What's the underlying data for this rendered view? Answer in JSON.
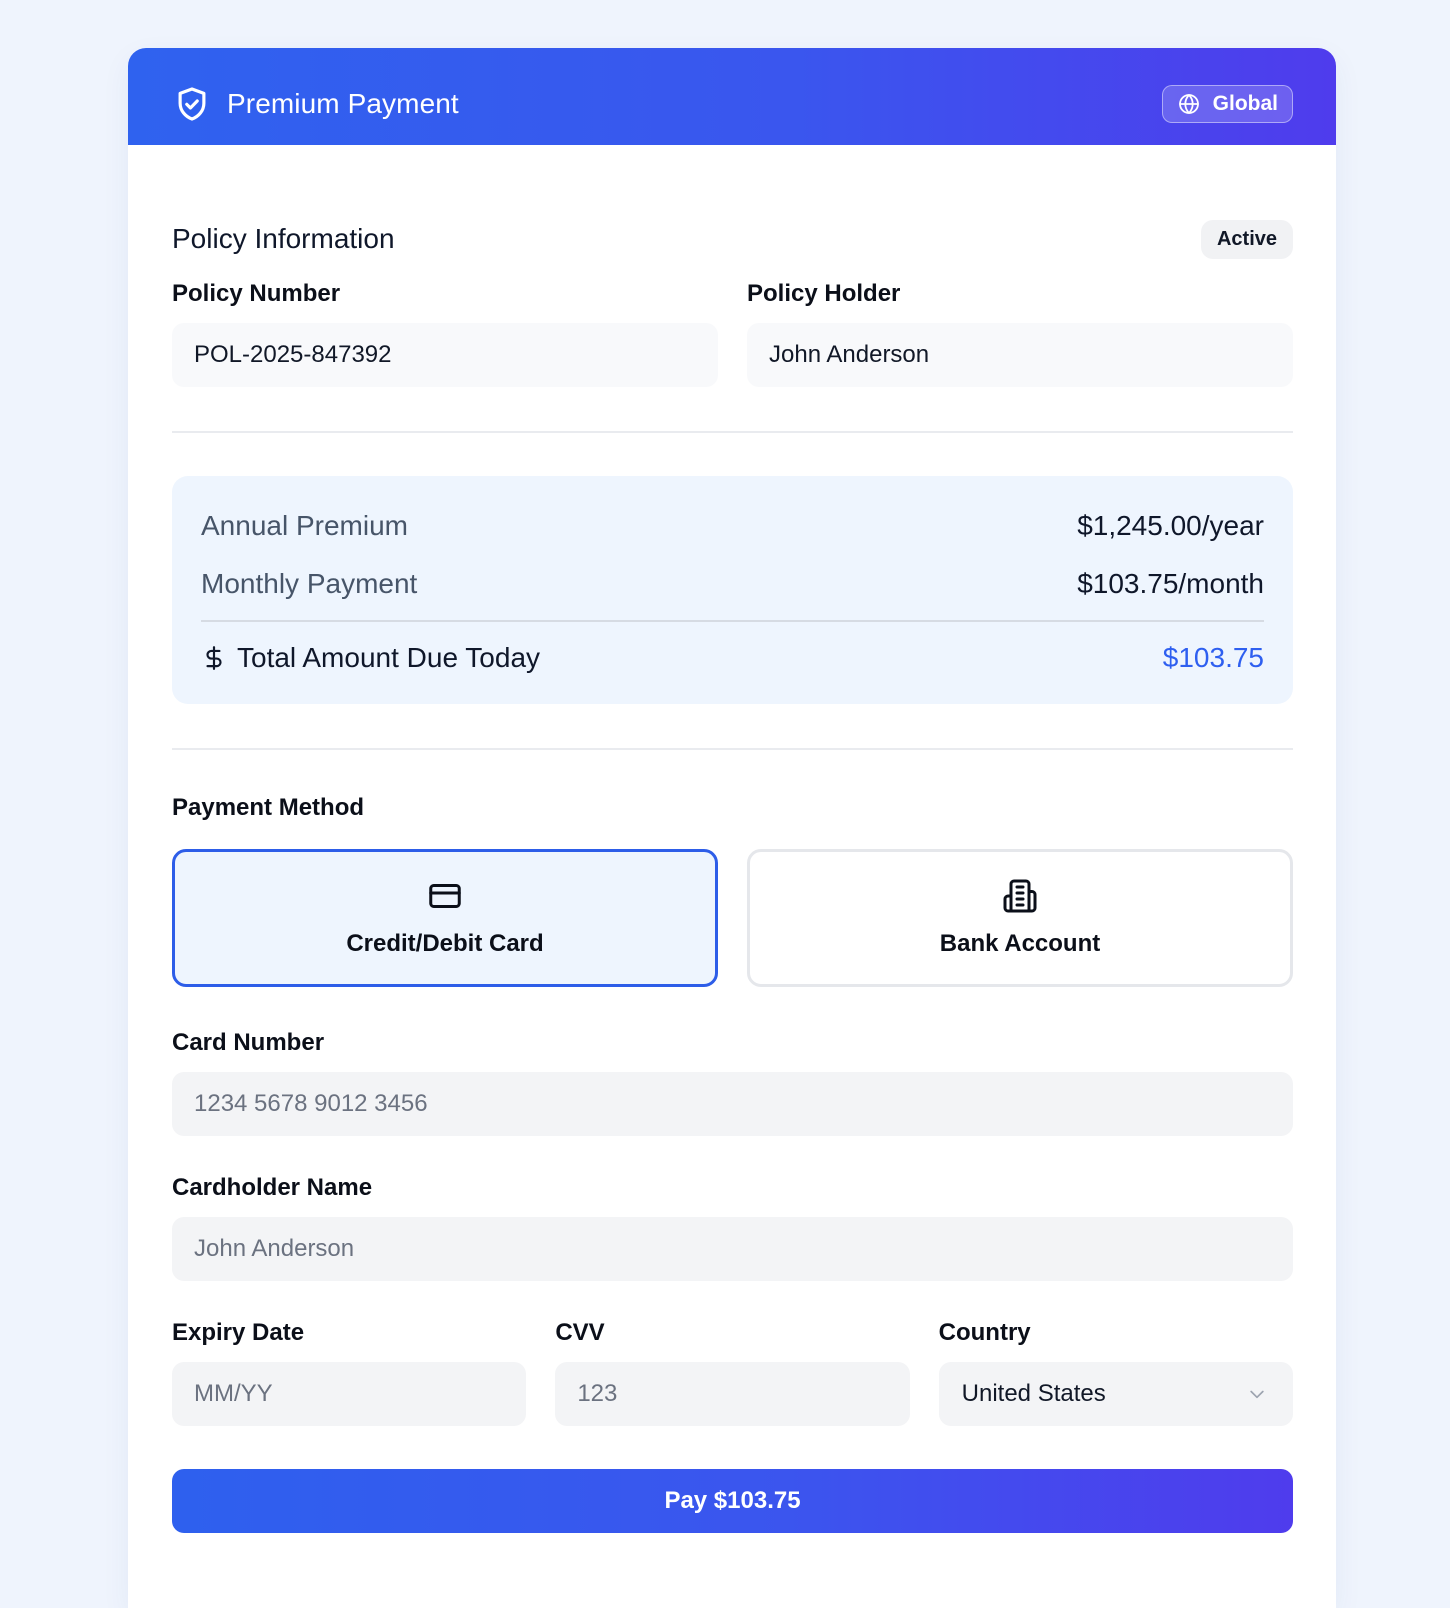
{
  "header": {
    "title": "Premium Payment",
    "region_label": "Global",
    "shield_icon": "shield-check-icon",
    "globe_icon": "globe-icon"
  },
  "policy": {
    "section_title": "Policy Information",
    "status": "Active",
    "number_label": "Policy Number",
    "number_value": "POL-2025-847392",
    "holder_label": "Policy Holder",
    "holder_value": "John Anderson"
  },
  "summary": {
    "annual_label": "Annual Premium",
    "annual_value": "$1,245.00/year",
    "monthly_label": "Monthly Payment",
    "monthly_value": "$103.75/month",
    "total_label": "Total Amount Due Today",
    "total_value": "$103.75",
    "total_icon": "dollar-icon"
  },
  "payment": {
    "section_label": "Payment Method",
    "methods": [
      {
        "label": "Credit/Debit Card",
        "icon": "credit-card-icon",
        "selected": true
      },
      {
        "label": "Bank Account",
        "icon": "bank-building-icon",
        "selected": false
      }
    ]
  },
  "form": {
    "card_number_label": "Card Number",
    "card_number_placeholder": "1234 5678 9012 3456",
    "cardholder_label": "Cardholder Name",
    "cardholder_placeholder": "John Anderson",
    "expiry_label": "Expiry Date",
    "expiry_placeholder": "MM/YY",
    "cvv_label": "CVV",
    "cvv_placeholder": "123",
    "country_label": "Country",
    "country_value": "United States"
  },
  "pay_button_label": "Pay $103.75",
  "colors": {
    "accent": "#2e5ff0",
    "gradient_start": "#2f62ef",
    "gradient_end": "#4f3ced",
    "page_background": "#eff4fd"
  }
}
